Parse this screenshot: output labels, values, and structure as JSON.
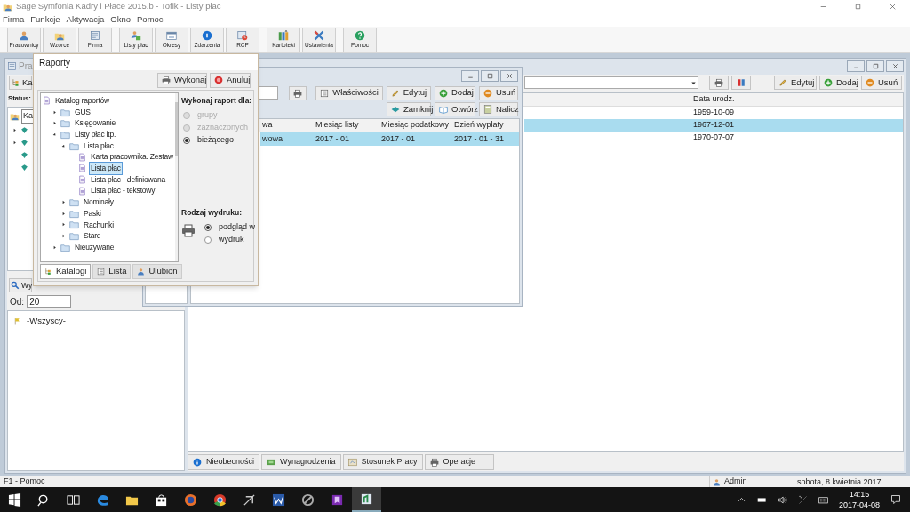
{
  "window": {
    "title": "Sage Symfonia Kadry i Płace 2015.b - Tofik - Listy płac"
  },
  "menu": [
    "Firma",
    "Funkcje",
    "Aktywacja",
    "Okno",
    "Pomoc"
  ],
  "toolbar": [
    [
      {
        "label": "Pracownicy"
      },
      {
        "label": "Wzorce"
      },
      {
        "label": "Firma"
      }
    ],
    [
      {
        "label": "Listy płac"
      },
      {
        "label": "Okresy"
      },
      {
        "label": "Zdarzenia"
      },
      {
        "label": "RCP"
      }
    ],
    [
      {
        "label": "Kartoteki"
      },
      {
        "label": "Ustawienia"
      }
    ],
    [
      {
        "label": "Pomoc"
      }
    ]
  ],
  "employees_window": {
    "title": "Pra",
    "catalog_button": "Ka",
    "status_label": "Status:",
    "tree_root": "Ka",
    "search_button": "Wy",
    "from_label": "Od:",
    "from_value": "20",
    "filter_items": [
      "-Wszyscy-"
    ],
    "buttons": [
      "Edytuj",
      "Dodaj",
      "Usuń"
    ],
    "columns": [
      "Data urodz."
    ],
    "rows": [
      {
        "cells": [
          "1959-10-09"
        ],
        "selected": false
      },
      {
        "cells": [
          "1967-12-01"
        ],
        "selected": true
      },
      {
        "cells": [
          "1970-07-07"
        ],
        "selected": false
      }
    ],
    "bottom_tabs": [
      "Nieobecności",
      "Wynagrodzenia",
      "Stosunek Pracy",
      "Operacje"
    ]
  },
  "payroll_window": {
    "buttons": [
      "Właściwości",
      "Edytuj",
      "Dodaj",
      "Usuń"
    ],
    "buttons_row_2": [
      "Zamknij",
      "Otwórz",
      "Nalicz"
    ],
    "columns": [
      "wa",
      "Miesiąc listy",
      "Miesiąc podatkowy",
      "Dzień wypłaty"
    ],
    "rows": [
      {
        "cells": [
          "wowa",
          "2017 - 01",
          "2017 - 01",
          "2017 - 01 - 31"
        ],
        "selected": true
      }
    ]
  },
  "reports_dialog": {
    "title": "Raporty",
    "buttons": [
      "Wykonaj",
      "Anuluj"
    ],
    "tree": [
      {
        "label": "Katalog raportów",
        "kind": "root",
        "selected": false,
        "children": [
          {
            "label": "GUS",
            "kind": "folder",
            "expanded": false,
            "selected": false
          },
          {
            "label": "Księgowanie",
            "kind": "folder",
            "expanded": false,
            "selected": false
          },
          {
            "label": "Listy płac itp.",
            "kind": "folder",
            "expanded": true,
            "selected": false,
            "children": [
              {
                "label": "Lista płac",
                "kind": "folder",
                "expanded": true,
                "selected": false,
                "children": [
                  {
                    "label": "Karta pracownika. Zestaw",
                    "kind": "report",
                    "selected": false
                  },
                  {
                    "label": "Lista płac",
                    "kind": "report",
                    "selected": true
                  },
                  {
                    "label": "Lista płac - definiowana",
                    "kind": "report",
                    "selected": false
                  },
                  {
                    "label": "Lista płac - tekstowy",
                    "kind": "report",
                    "selected": false
                  }
                ]
              },
              {
                "label": "Nominały",
                "kind": "folder",
                "expanded": false,
                "selected": false
              },
              {
                "label": "Paski",
                "kind": "folder",
                "expanded": false,
                "selected": false
              },
              {
                "label": "Rachunki",
                "kind": "folder",
                "expanded": false,
                "selected": false
              },
              {
                "label": "Stare",
                "kind": "folder",
                "expanded": false,
                "selected": false
              }
            ]
          },
          {
            "label": "Nieużywane",
            "kind": "folder",
            "expanded": false,
            "selected": false
          }
        ]
      }
    ],
    "scope_label": "Wykonaj raport dla:",
    "scope_options": [
      {
        "label": "grupy",
        "selected": false,
        "disabled": true
      },
      {
        "label": "zaznaczonych",
        "selected": false,
        "disabled": true
      },
      {
        "label": "bieżącego",
        "selected": true,
        "disabled": false
      }
    ],
    "output_label": "Rodzaj wydruku:",
    "output_options": [
      {
        "label": "podgląd w",
        "selected": true
      },
      {
        "label": "wydruk",
        "selected": false
      }
    ],
    "tabs": [
      {
        "label": "Katalogi",
        "selected": true
      },
      {
        "label": "Lista",
        "selected": false
      },
      {
        "label": "Ulubion",
        "selected": false
      }
    ]
  },
  "status_bar": {
    "help": "F1 - Pomoc",
    "user": "Admin",
    "date": "sobota, 8 kwietnia 2017"
  },
  "taskbar": {
    "time": "14:15",
    "date": "2017-04-08"
  }
}
